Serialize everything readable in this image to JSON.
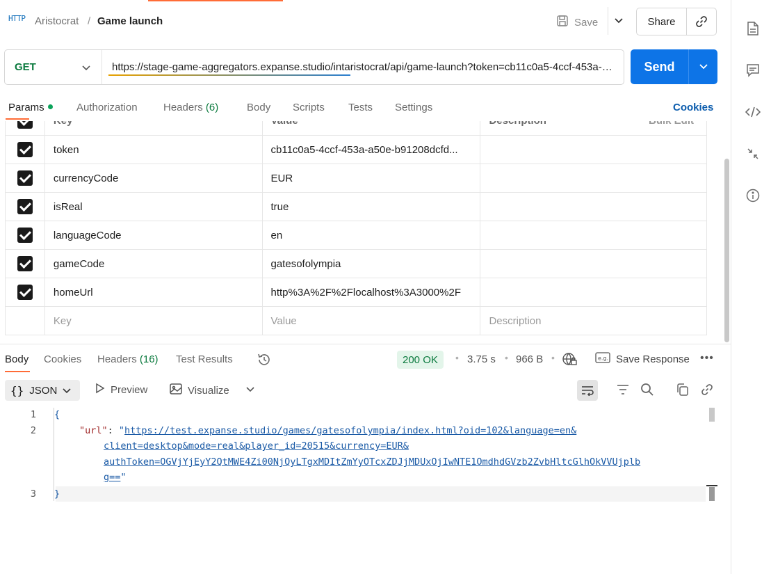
{
  "header": {
    "badge": "HTTP",
    "breadcrumb_parent": "Aristocrat",
    "breadcrumb_sep": "/",
    "breadcrumb_current": "Game launch",
    "save_label": "Save",
    "share_label": "Share"
  },
  "request": {
    "method": "GET",
    "url": "https://stage-game-aggregators.expanse.studio/intaristocrat/api/game-launch?token=cb11c0a5-4ccf-453a-a50e-b91208dcfd...",
    "send_label": "Send"
  },
  "request_tabs": {
    "params": "Params",
    "authorization": "Authorization",
    "headers": "Headers",
    "headers_count": "(6)",
    "body": "Body",
    "scripts": "Scripts",
    "tests": "Tests",
    "settings": "Settings",
    "cookies": "Cookies"
  },
  "params": {
    "col_key": "Key",
    "col_value": "Value",
    "col_description": "Description",
    "bulk_edit": "Bulk Edit",
    "rows": [
      {
        "key": "token",
        "value": "cb11c0a5-4ccf-453a-a50e-b91208dcfd..."
      },
      {
        "key": "currencyCode",
        "value": "EUR"
      },
      {
        "key": "isReal",
        "value": "true"
      },
      {
        "key": "languageCode",
        "value": "en"
      },
      {
        "key": "gameCode",
        "value": "gatesofolympia"
      },
      {
        "key": "homeUrl",
        "value": "http%3A%2F%2Flocalhost%3A3000%2F"
      }
    ],
    "placeholder_key": "Key",
    "placeholder_value": "Value",
    "placeholder_description": "Description"
  },
  "response_tabs": {
    "body": "Body",
    "cookies": "Cookies",
    "headers": "Headers",
    "headers_count": "(16)",
    "test_results": "Test Results"
  },
  "response_meta": {
    "status": "200 OK",
    "time": "3.75 s",
    "size": "966 B",
    "save_response": "Save Response"
  },
  "response_toolbar": {
    "format": "JSON",
    "preview": "Preview",
    "visualize": "Visualize"
  },
  "code": {
    "line1_num": "1",
    "line2_num": "2",
    "line3_num": "3",
    "open_brace": "{",
    "close_brace": "}",
    "key": "\"url\"",
    "colon": ": ",
    "quote": "\"",
    "url_part1": "https://test.expanse.studio/games/gatesofolympia/index.html?oid=102&language=en&",
    "url_part2": "client=desktop&mode=real&player_id=20515&currency=EUR&",
    "url_part3": "authToken=OGVjYjEyY2QtMWE4Zi00NjQyLTgxMDItZmYyOTcxZDJjMDUxOjIwNTE1OmdhdGVzb2ZvbHltcGlhOkVVUjplb",
    "url_part4": "g=="
  }
}
